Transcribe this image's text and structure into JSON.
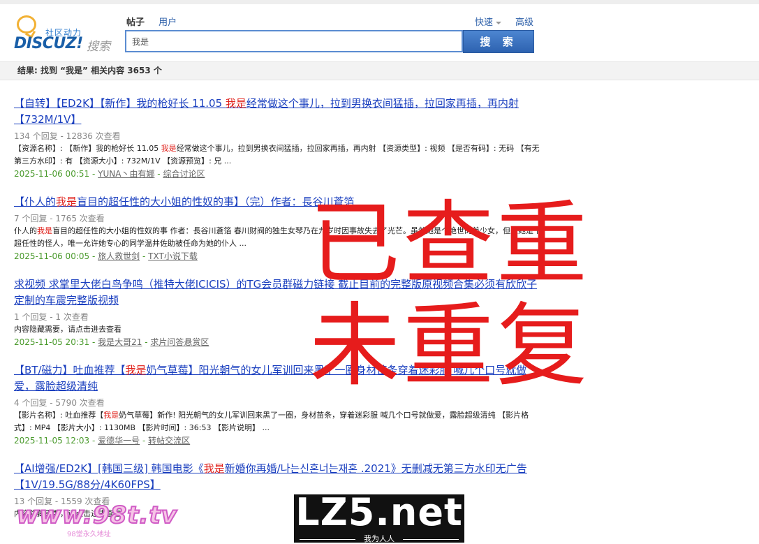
{
  "header": {
    "logo_slogan": "社区动力",
    "logo_brand": "DISCUZ!",
    "logo_sub": "搜索",
    "tabs": [
      "帖子",
      "用户"
    ],
    "quick_label": "快速",
    "advanced_label": "高级",
    "search_value": "我是",
    "search_button": "搜 索"
  },
  "result_bar": "结果: 找到 “我是” 相关内容 3653 个",
  "results": [
    {
      "title_pre": "【自转】【ED2K】【新作】我的枪好长 11.05 ",
      "title_hl": "我是",
      "title_post": "经常做这个事儿，拉到男换衣间猛插，拉回家再插，再内射【732M/1V】",
      "stats": "134 个回复 - 12836 次查看",
      "snippet_pre": "【资源名称】: 【新作】我的枪好长 11.05 ",
      "snippet_hl": "我是",
      "snippet_post": "经常做这个事儿，拉到男换衣间猛插，拉回家再插，再内射 【资源类型】: 视频 【是否有码】: 无码 【有无第三方水印】: 有 【资源大小】: 732M/1V 【资源预览】: 兄 ...",
      "time": "2025-11-06 00:51",
      "author": "YUNA丶由有娜",
      "forum": "综合讨论区"
    },
    {
      "title_pre": "【仆人的",
      "title_hl": "我是",
      "title_post": "盲目的超任性的大小姐的性奴的事】（完）作者：長谷川蒼箔",
      "stats": "7 个回复 - 1765 次查看",
      "snippet_pre": "仆人的",
      "snippet_hl": "我是",
      "snippet_post": "盲目的超任性的大小姐的性奴的事 作者：長谷川蒼箔 春川财阀的独生女琴乃在九岁时因事故失去了光芒。虽然她是个绝世的美少女，但是她是个超任性的怪人，唯一允许她专心的同学温井佐助被任命为她的仆人 ...",
      "time": "2025-11-06 00:05",
      "author": "旅人救世剑",
      "forum": "TXT小说下载"
    },
    {
      "title_pre": "求视频 求掌里大佬白鸟争鸣（推特大佬ICICIS）的TG会员群磁力链接 截止目前的完整版原视频合集必须有欣欣子定制的车震完整版视频",
      "title_hl": "",
      "title_post": "",
      "stats": "1 个回复 - 1 次查看",
      "snippet_pre": "内容隐藏需要，请点击进去查看",
      "snippet_hl": "",
      "snippet_post": "",
      "time": "2025-11-05 20:31",
      "author": "我是大哥21",
      "forum": "求片问答悬赏区"
    },
    {
      "title_pre": "【BT/磁力】吐血推荐【",
      "title_hl": "我是",
      "title_post": "奶气草莓】阳光朝气的女儿军训回来黑了一圈身材苗条穿着迷彩服 喊几个口号就做爱，露脸超级清纯",
      "stats": "4 个回复 - 5790 次查看",
      "snippet_pre": "【影片名称】: 吐血推荐【",
      "snippet_hl": "我是",
      "snippet_post": "奶气草莓】新作! 阳光朝气的女儿军训回来黑了一圈，身材苗条，穿着迷彩服 喊几个口号就做爱，露脸超级清纯 【影片格式】: MP4 【影片大小】: 1130MB 【影片时间】: 36:53 【影片说明】 ...",
      "time": "2025-11-05 12:03",
      "author": "爱德华一号",
      "forum": "转帖交流区"
    },
    {
      "title_pre": "【AI增强/ED2K】[韩国三级] 韩国电影《",
      "title_hl": "我是",
      "title_post": "新婚你再婚/나는신혼너는재혼 .2021》无删减无第三方水印无广告【1V/19.5G/88分/4K60FPS】",
      "stats": "13 个回复 - 1559 次查看",
      "snippet_pre": "内容隐藏需要，请点击进去查看",
      "snippet_hl": "",
      "snippet_post": "",
      "time": "",
      "author": "",
      "forum": ""
    }
  ],
  "overlay": {
    "stamp_line1": "已查重",
    "stamp_line2": "未重复",
    "watermark_98t": "www.98t.tv",
    "watermark_98t_sub": "98堂永久地址",
    "lz5_text": "LZ5.net",
    "lz5_sub": "我为人人",
    "stamp_color": "#e61c1c"
  }
}
